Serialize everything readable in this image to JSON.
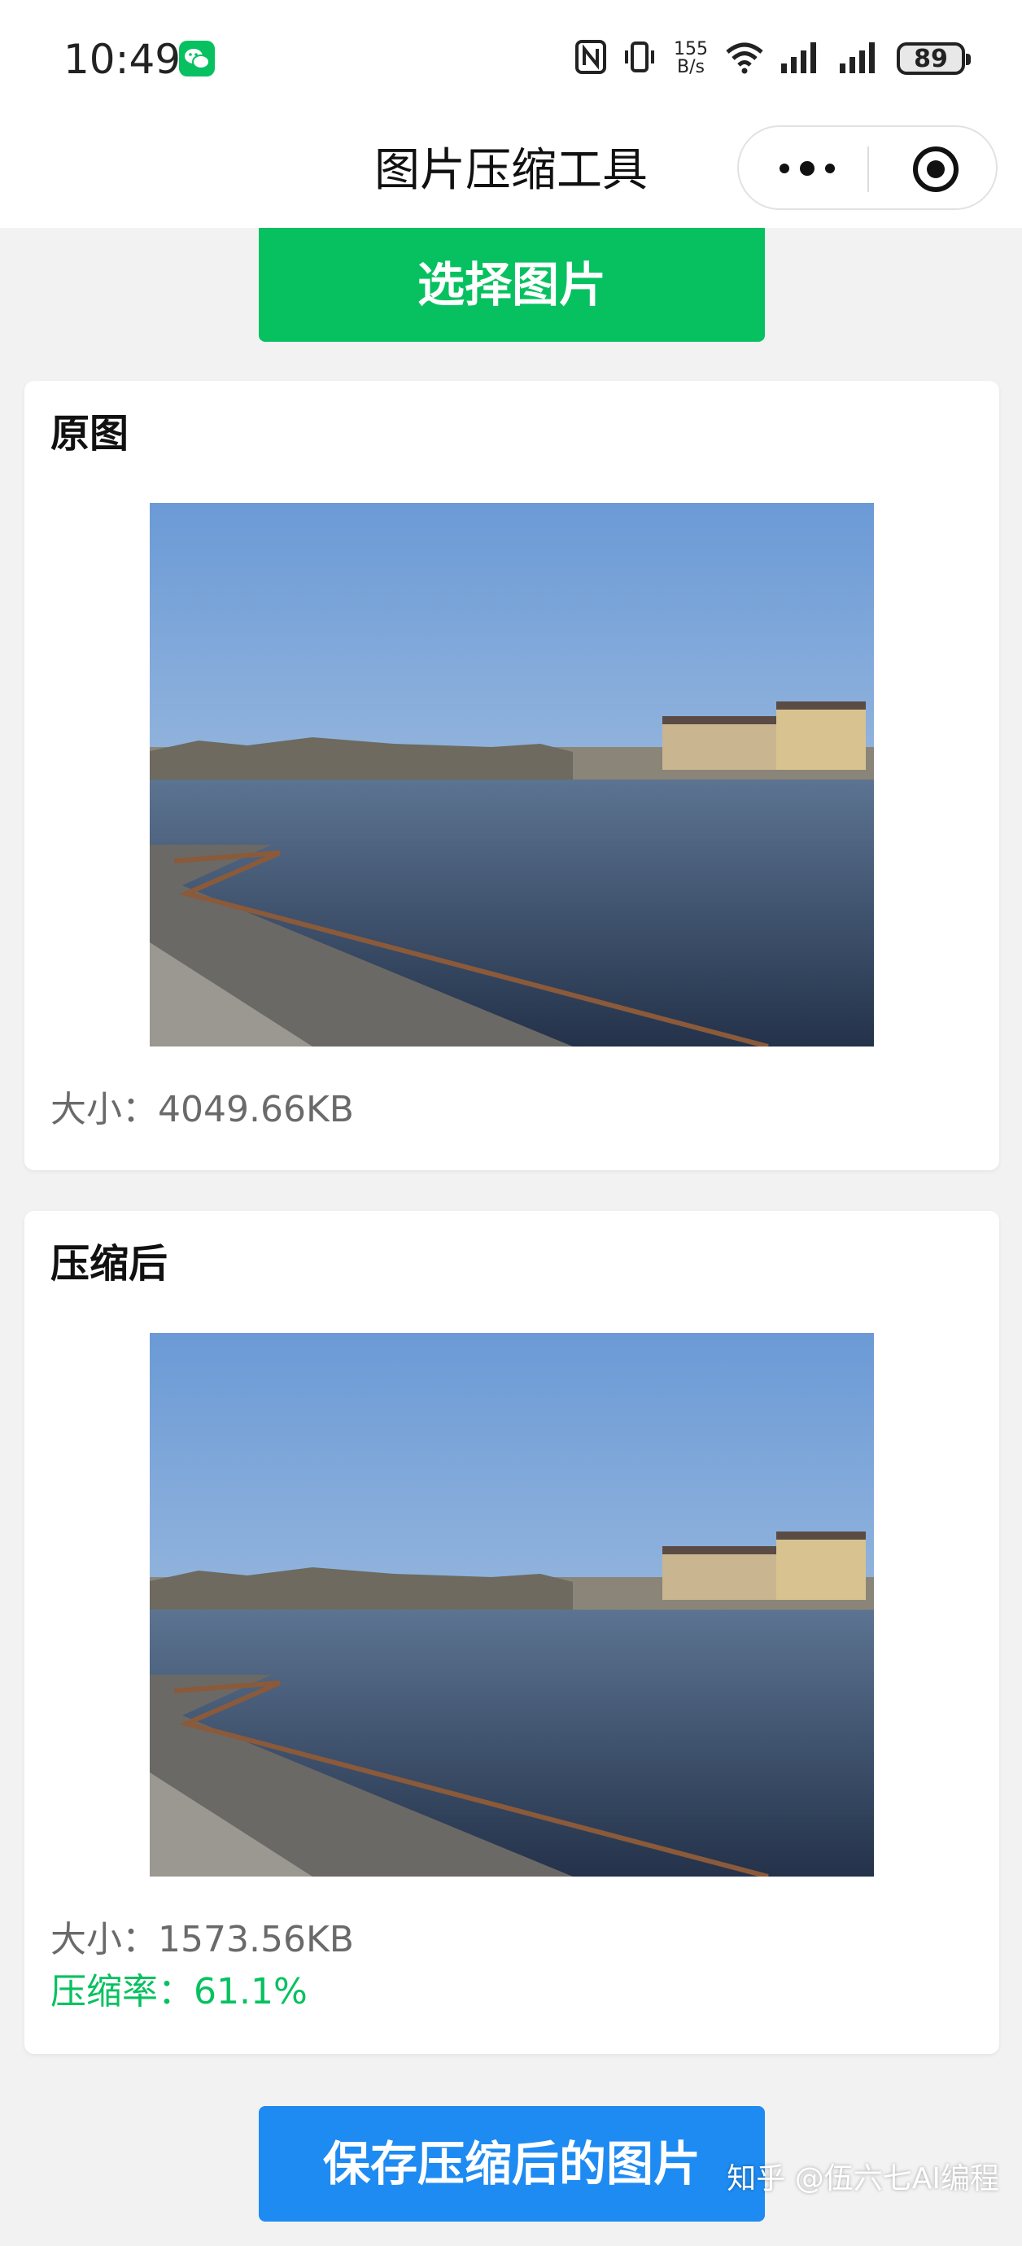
{
  "status_bar": {
    "time": "10:49",
    "net_speed_value": "155",
    "net_speed_unit": "B/s",
    "battery": "89"
  },
  "nav": {
    "title": "图片压缩工具"
  },
  "actions": {
    "select_label": "选择图片",
    "save_label": "保存压缩后的图片"
  },
  "original": {
    "title": "原图",
    "size_text": "大小：4049.66KB"
  },
  "compressed": {
    "title": "压缩后",
    "size_text": "大小：1573.56KB",
    "ratio_text": "压缩率：61.1%"
  },
  "watermark": "知乎 @伍六七AI编程",
  "colors": {
    "accent_green": "#07c160",
    "accent_blue": "#1e8bf2"
  }
}
